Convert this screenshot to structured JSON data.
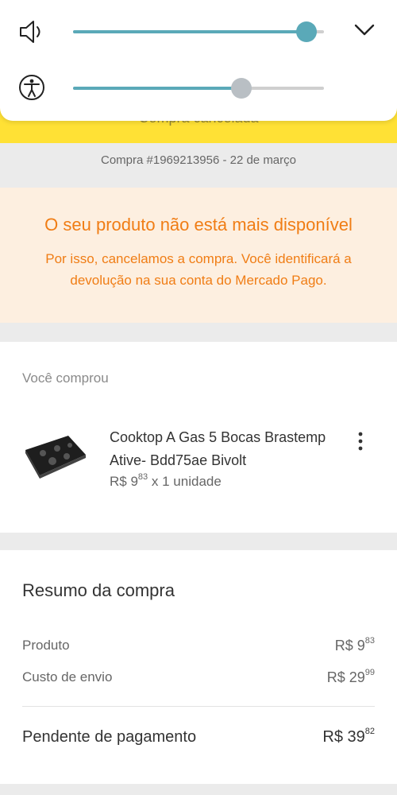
{
  "header": {
    "title": "Compra cancelada"
  },
  "volume_panel": {
    "media_volume": 0.93,
    "accessibility_volume": 0.67,
    "colors": {
      "track_active": "#5aa9b8",
      "thumb_inactive": "#b9bfc4"
    },
    "icons": [
      "speaker-icon",
      "accessibility-icon",
      "chevron-down-icon"
    ]
  },
  "order": {
    "line": "Compra #1969213956 - 22 de março"
  },
  "warning": {
    "title": "O seu produto não está mais disponível",
    "message": "Por isso, cancelamos a compra. Você identificará a devolução na sua conta do Mercado Pago.",
    "color": "#f07d15"
  },
  "purchase": {
    "label": "Você comprou",
    "product_name": "Cooktop A Gas 5 Bocas Brastemp Ative- Bdd75ae Bivolt",
    "price_int": "R$ 9",
    "price_cents": "83",
    "quantity": "x 1 unidade"
  },
  "summary": {
    "title": "Resumo da compra",
    "rows": [
      {
        "label": "Produto",
        "amount_int": "R$ 9",
        "amount_cents": "83"
      },
      {
        "label": "Custo de envio",
        "amount_int": "R$ 29",
        "amount_cents": "99"
      }
    ],
    "total": {
      "label": "Pendente de pagamento",
      "amount_int": "R$ 39",
      "amount_cents": "82"
    }
  }
}
